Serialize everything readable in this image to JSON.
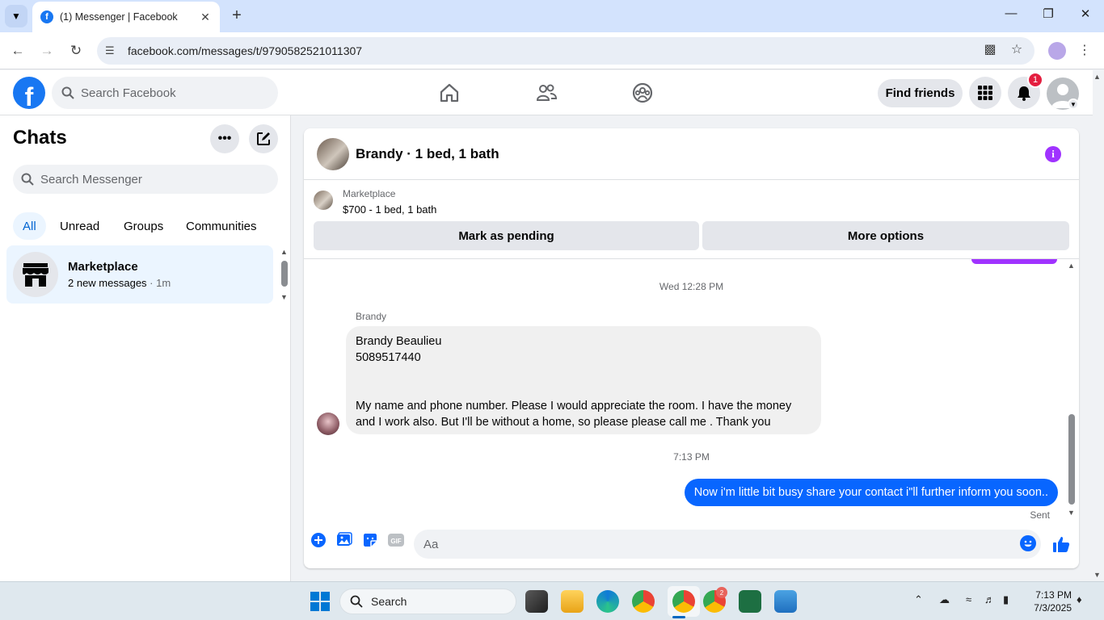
{
  "browser": {
    "tab_title": "(1) Messenger | Facebook",
    "tab_favicon": "f",
    "url": "facebook.com/messages/t/9790582521011307"
  },
  "fb_header": {
    "search_placeholder": "Search Facebook",
    "find_friends": "Find friends",
    "notification_count": "1",
    "brand_color": "#1877f2"
  },
  "sidebar": {
    "title": "Chats",
    "search_placeholder": "Search Messenger",
    "filters": [
      "All",
      "Unread",
      "Groups",
      "Communities"
    ],
    "chats": [
      {
        "name": "Marketplace",
        "preview": "2 new messages",
        "time": "1m"
      }
    ]
  },
  "conversation": {
    "title": "Brandy · 1 bed, 1 bath",
    "marketplace_label": "Marketplace",
    "listing": "$700 - 1 bed, 1 bath",
    "btn_pending": "Mark as pending",
    "btn_more": "More options",
    "timestamp_1": "Wed 12:28 PM",
    "sender": "Brandy",
    "received_lines": [
      "Brandy Beaulieu",
      "5089517440",
      "My name and phone number. Please  I would appreciate the room. I have the money",
      "and I work also. But I'll be without a home, so please please call me . Thank you"
    ],
    "timestamp_2": "7:13 PM",
    "sent_message": "Now i'm little bit busy share your contact i\"ll further inform you soon..",
    "sent_status": "Sent",
    "composer_placeholder": "Aa",
    "gif_label": "GIF",
    "accent_color": "#0866ff",
    "info_color": "#a033ff"
  },
  "taskbar": {
    "search_placeholder": "Search",
    "time": "7:13 PM",
    "date": "7/3/2025",
    "chrome_badge": "2"
  }
}
